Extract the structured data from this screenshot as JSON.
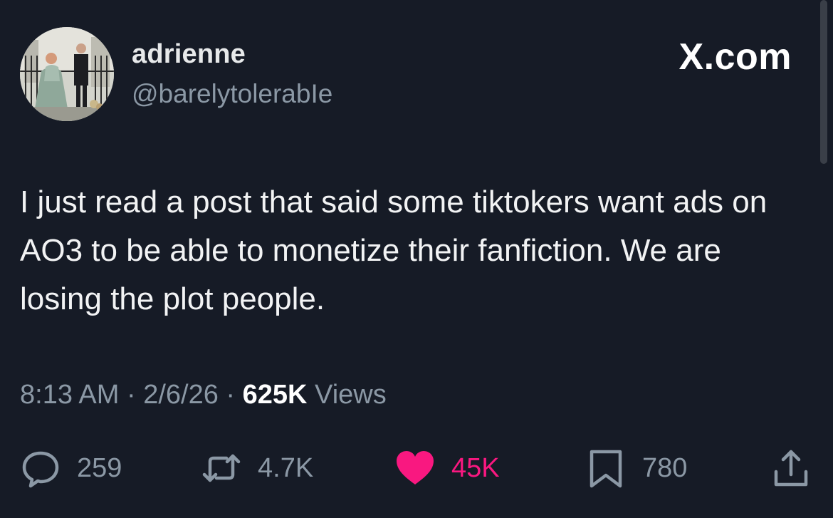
{
  "author": {
    "display_name": "adrienne",
    "handle": "@barelytolerabIe"
  },
  "brand": "X.com",
  "tweet": {
    "text": "I just read a post that said some tiktokers want ads on AO3 to be able to monetize their fanfiction. We are losing the plot people."
  },
  "meta": {
    "time": "8:13 AM",
    "separator": "·",
    "date": "2/6/26",
    "views_count": "625K",
    "views_label": "Views"
  },
  "actions": {
    "replies": "259",
    "reposts": "4.7K",
    "likes": "45K",
    "bookmarks": "780"
  },
  "icons": {
    "reply": "reply-icon",
    "repost": "repost-icon",
    "like": "heart-icon",
    "bookmark": "bookmark-icon",
    "share": "share-icon"
  },
  "colors": {
    "background": "#161b26",
    "text": "#e7e9ea",
    "muted": "#8b98a5",
    "like": "#f91880"
  }
}
